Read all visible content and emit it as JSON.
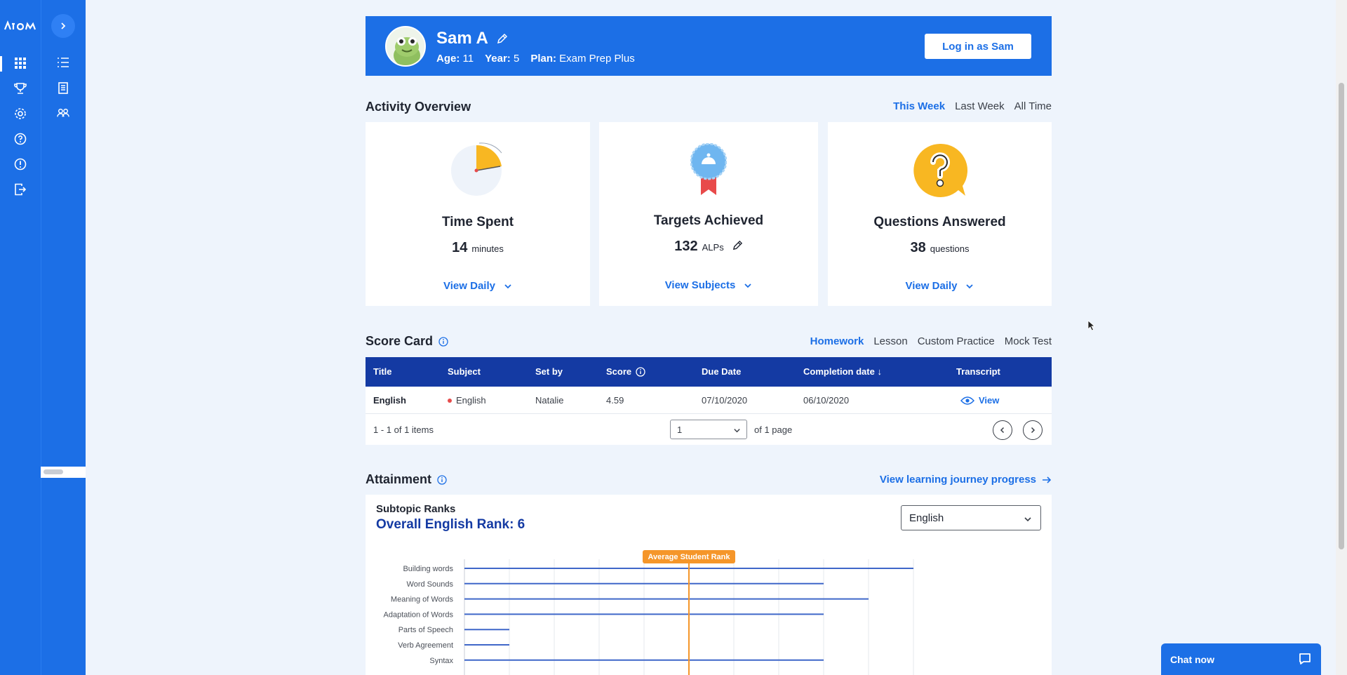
{
  "nav": {
    "logo": "ATOM",
    "expand_label": ">"
  },
  "profile": {
    "name": "Sam A",
    "age_label": "Age:",
    "age": "11",
    "year_label": "Year:",
    "year": "5",
    "plan_label": "Plan:",
    "plan": "Exam Prep Plus",
    "login_button": "Log in as Sam"
  },
  "activity": {
    "title": "Activity Overview",
    "ranges": [
      "This Week",
      "Last Week",
      "All Time"
    ],
    "time_spent": {
      "title": "Time Spent",
      "value": "14",
      "unit": "minutes",
      "link": "View Daily"
    },
    "targets": {
      "title": "Targets Achieved",
      "value": "132",
      "unit": "ALPs",
      "link": "View Subjects"
    },
    "questions": {
      "title": "Questions Answered",
      "value": "38",
      "unit": "questions",
      "link": "View Daily"
    }
  },
  "scorecard": {
    "title": "Score Card",
    "tabs": [
      "Homework",
      "Lesson",
      "Custom Practice",
      "Mock Test"
    ],
    "columns": [
      "Title",
      "Subject",
      "Set by",
      "Score",
      "Due Date",
      "Completion date ↓",
      "Transcript"
    ],
    "rows": [
      {
        "title": "English",
        "subject": "English",
        "set_by": "Natalie",
        "score": "4.59",
        "due": "07/10/2020",
        "completed": "06/10/2020",
        "transcript": "View"
      }
    ],
    "items_text": "1 - 1 of 1 items",
    "page_value": "1",
    "page_total": "of 1 page"
  },
  "attainment": {
    "title": "Attainment",
    "link": "View learning journey progress",
    "subtitle": "Subtopic Ranks",
    "overall": "Overall English Rank: 6",
    "subject_select": "English"
  },
  "chart_data": {
    "type": "bar",
    "orientation": "horizontal",
    "categories": [
      "Building words",
      "Word Sounds",
      "Meaning of Words",
      "Adaptation of Words",
      "Parts of Speech",
      "Verb Agreement",
      "Syntax"
    ],
    "values": [
      10,
      8,
      9,
      8,
      1,
      1,
      8
    ],
    "xlim": [
      0,
      10
    ],
    "reference_line": {
      "label": "Average Student Rank",
      "value": 5
    },
    "grid": true,
    "colors": {
      "bar": "#3f67c9",
      "reference": "#f5962a"
    }
  },
  "chat": {
    "label": "Chat now"
  },
  "colors": {
    "brand": "#1c6fe6",
    "navy": "#143aa3",
    "accent": "#f5962a"
  }
}
